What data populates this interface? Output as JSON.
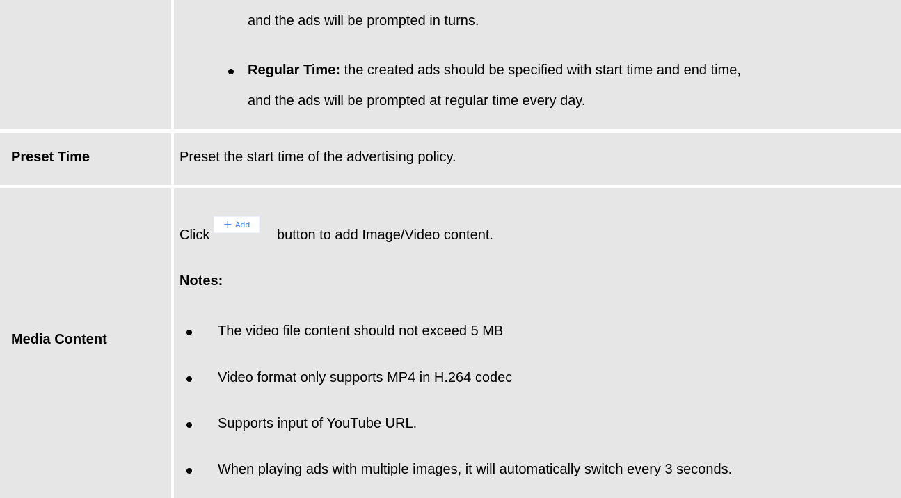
{
  "rows": [
    {
      "label": "",
      "lines": {
        "cont": "and the ads will be prompted in turns.",
        "regular_term": "Regular Time:",
        "regular_desc_1": " the created ads should be specified with start time and end time,",
        "regular_desc_2": "and the ads will be prompted at regular time every day."
      }
    },
    {
      "label": "Preset Time",
      "description": "Preset the start time of the advertising policy."
    },
    {
      "label": "Media Content",
      "click_prefix": "Click",
      "add_button_plus": "+",
      "add_button_label": "Add",
      "click_suffix": "button to add Image/Video content.",
      "notes_heading": "Notes:",
      "notes": [
        "The video file content should not exceed 5 MB",
        "Video format only supports MP4 in H.264 codec",
        "Supports input of YouTube URL.",
        "When playing ads with multiple images, it will automatically switch every 3 seconds."
      ]
    }
  ],
  "colors": {
    "cell_background": "#e6e6e6",
    "accent_blue": "#3b7cf7"
  }
}
